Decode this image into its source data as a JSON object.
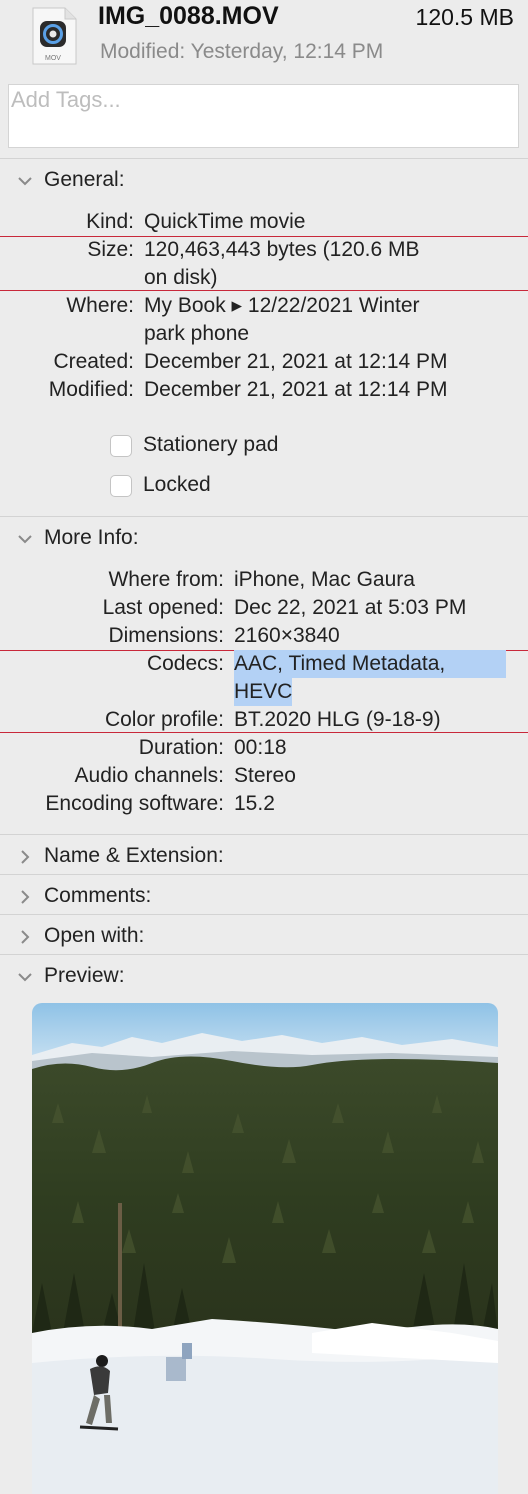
{
  "header": {
    "filename": "IMG_0088.MOV",
    "size": "120.5 MB",
    "modified": "Modified: Yesterday, 12:14 PM",
    "icon": "quicktime-mov-file-icon",
    "icon_badge": "MOV"
  },
  "tags": {
    "placeholder": "Add Tags..."
  },
  "general": {
    "title": "General:",
    "kind_label": "Kind:",
    "kind": "QuickTime movie",
    "size_label": "Size:",
    "size_line1": "120,463,443 bytes (120.6 MB",
    "size_line2": "on disk)",
    "where_label": "Where:",
    "where_line1": "My Book ▸ 12/22/2021 Winter",
    "where_line2": "park phone",
    "created_label": "Created:",
    "created": "December 21, 2021 at 12:14 PM",
    "modified_label": "Modified:",
    "modified": "December 21, 2021 at 12:14 PM",
    "stationery": "Stationery pad",
    "locked": "Locked"
  },
  "more_info": {
    "title": "More Info:",
    "where_from_label": "Where from:",
    "where_from": "iPhone, Mac Gaura",
    "last_opened_label": "Last opened:",
    "last_opened": "Dec 22, 2021 at 5:03 PM",
    "dimensions_label": "Dimensions:",
    "dimensions": "2160×3840",
    "codecs_label": "Codecs:",
    "codecs_line1": "AAC, Timed Metadata,",
    "codecs_line2": "HEVC",
    "color_profile_label": "Color profile:",
    "color_profile": "BT.2020 HLG (9-18-9)",
    "duration_label": "Duration:",
    "duration": "00:18",
    "audio_label": "Audio channels:",
    "audio": "Stereo",
    "encoding_label": "Encoding software:",
    "encoding": "15.2"
  },
  "sections": {
    "name_ext": "Name & Extension:",
    "comments": "Comments:",
    "open_with": "Open with:",
    "preview": "Preview:"
  },
  "colors": {
    "accent_highlight": "#b3d1f5",
    "annotation_line": "#c8283a"
  }
}
